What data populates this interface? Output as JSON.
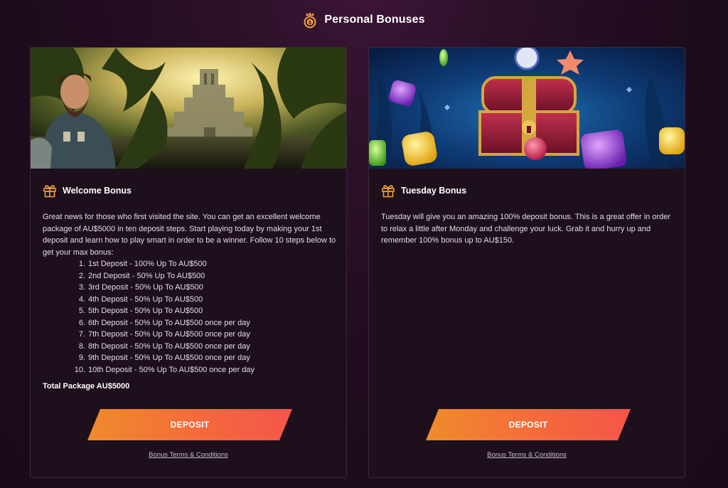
{
  "header": {
    "title": "Personal Bonuses",
    "icon": "coin-crown-icon"
  },
  "cards": [
    {
      "title": "Welcome Bonus",
      "icon": "gift-icon",
      "description": "Great news for those who first visited the site. You can get an excellent welcome package of AU$5000 in ten deposit steps. Start playing today by making your 1st deposit and learn how to play smart in order to be a winner. Follow 10 steps below to get your max bonus:",
      "steps": [
        {
          "num": "1.",
          "text": "1st Deposit - 100% Up To AU$500"
        },
        {
          "num": "2.",
          "text": "2nd Deposit - 50% Up To AU$500"
        },
        {
          "num": "3.",
          "text": "3rd Deposit - 50% Up To AU$500"
        },
        {
          "num": "4.",
          "text": "4th Deposit - 50% Up To AU$500"
        },
        {
          "num": "5.",
          "text": "5th Deposit - 50% Up To AU$500"
        },
        {
          "num": "6.",
          "text": "6th Deposit - 50% Up To AU$500 once per day"
        },
        {
          "num": "7.",
          "text": "7th Deposit - 50% Up To AU$500 once per day"
        },
        {
          "num": "8.",
          "text": "8th Deposit - 50% Up To AU$500 once per day"
        },
        {
          "num": "9.",
          "text": "9th Deposit - 50% Up To AU$500 once per day"
        },
        {
          "num": "10.",
          "text": "10th Deposit - 50% Up To AU$500 once per day"
        }
      ],
      "total": "Total Package AU$5000",
      "button_label": "DEPOSIT",
      "terms_label": "Bonus Terms & Conditions"
    },
    {
      "title": "Tuesday Bonus",
      "icon": "gift-icon",
      "description": "Tuesday will give you an amazing 100% deposit bonus. This is a great offer in order to relax a little after Monday and challenge your luck. Grab it and hurry up and remember 100% bonus up to AU$150.",
      "button_label": "DEPOSIT",
      "terms_label": "Bonus Terms & Conditions"
    }
  ],
  "colors": {
    "background": "#1f0c1d",
    "card": "#1d0f1c",
    "accent_orange": "#f08b2b",
    "accent_red": "#f5554a",
    "gift_icon": "#f0a23c"
  }
}
